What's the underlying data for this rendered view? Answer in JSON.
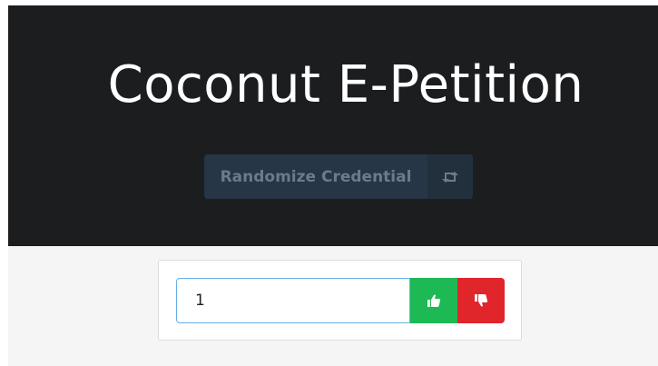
{
  "header": {
    "title": "Coconut E-Petition",
    "randomize_label": "Randomize Credential",
    "randomize_icon": "retweet-icon"
  },
  "vote": {
    "input_value": "1",
    "up_icon": "thumbs-up-icon",
    "down_icon": "thumbs-down-icon"
  },
  "colors": {
    "hero_bg": "#1c1d1f",
    "randomize_bg": "#263646",
    "upvote": "#1db954",
    "downvote": "#e0252b",
    "page_bg": "#f5f5f5"
  }
}
